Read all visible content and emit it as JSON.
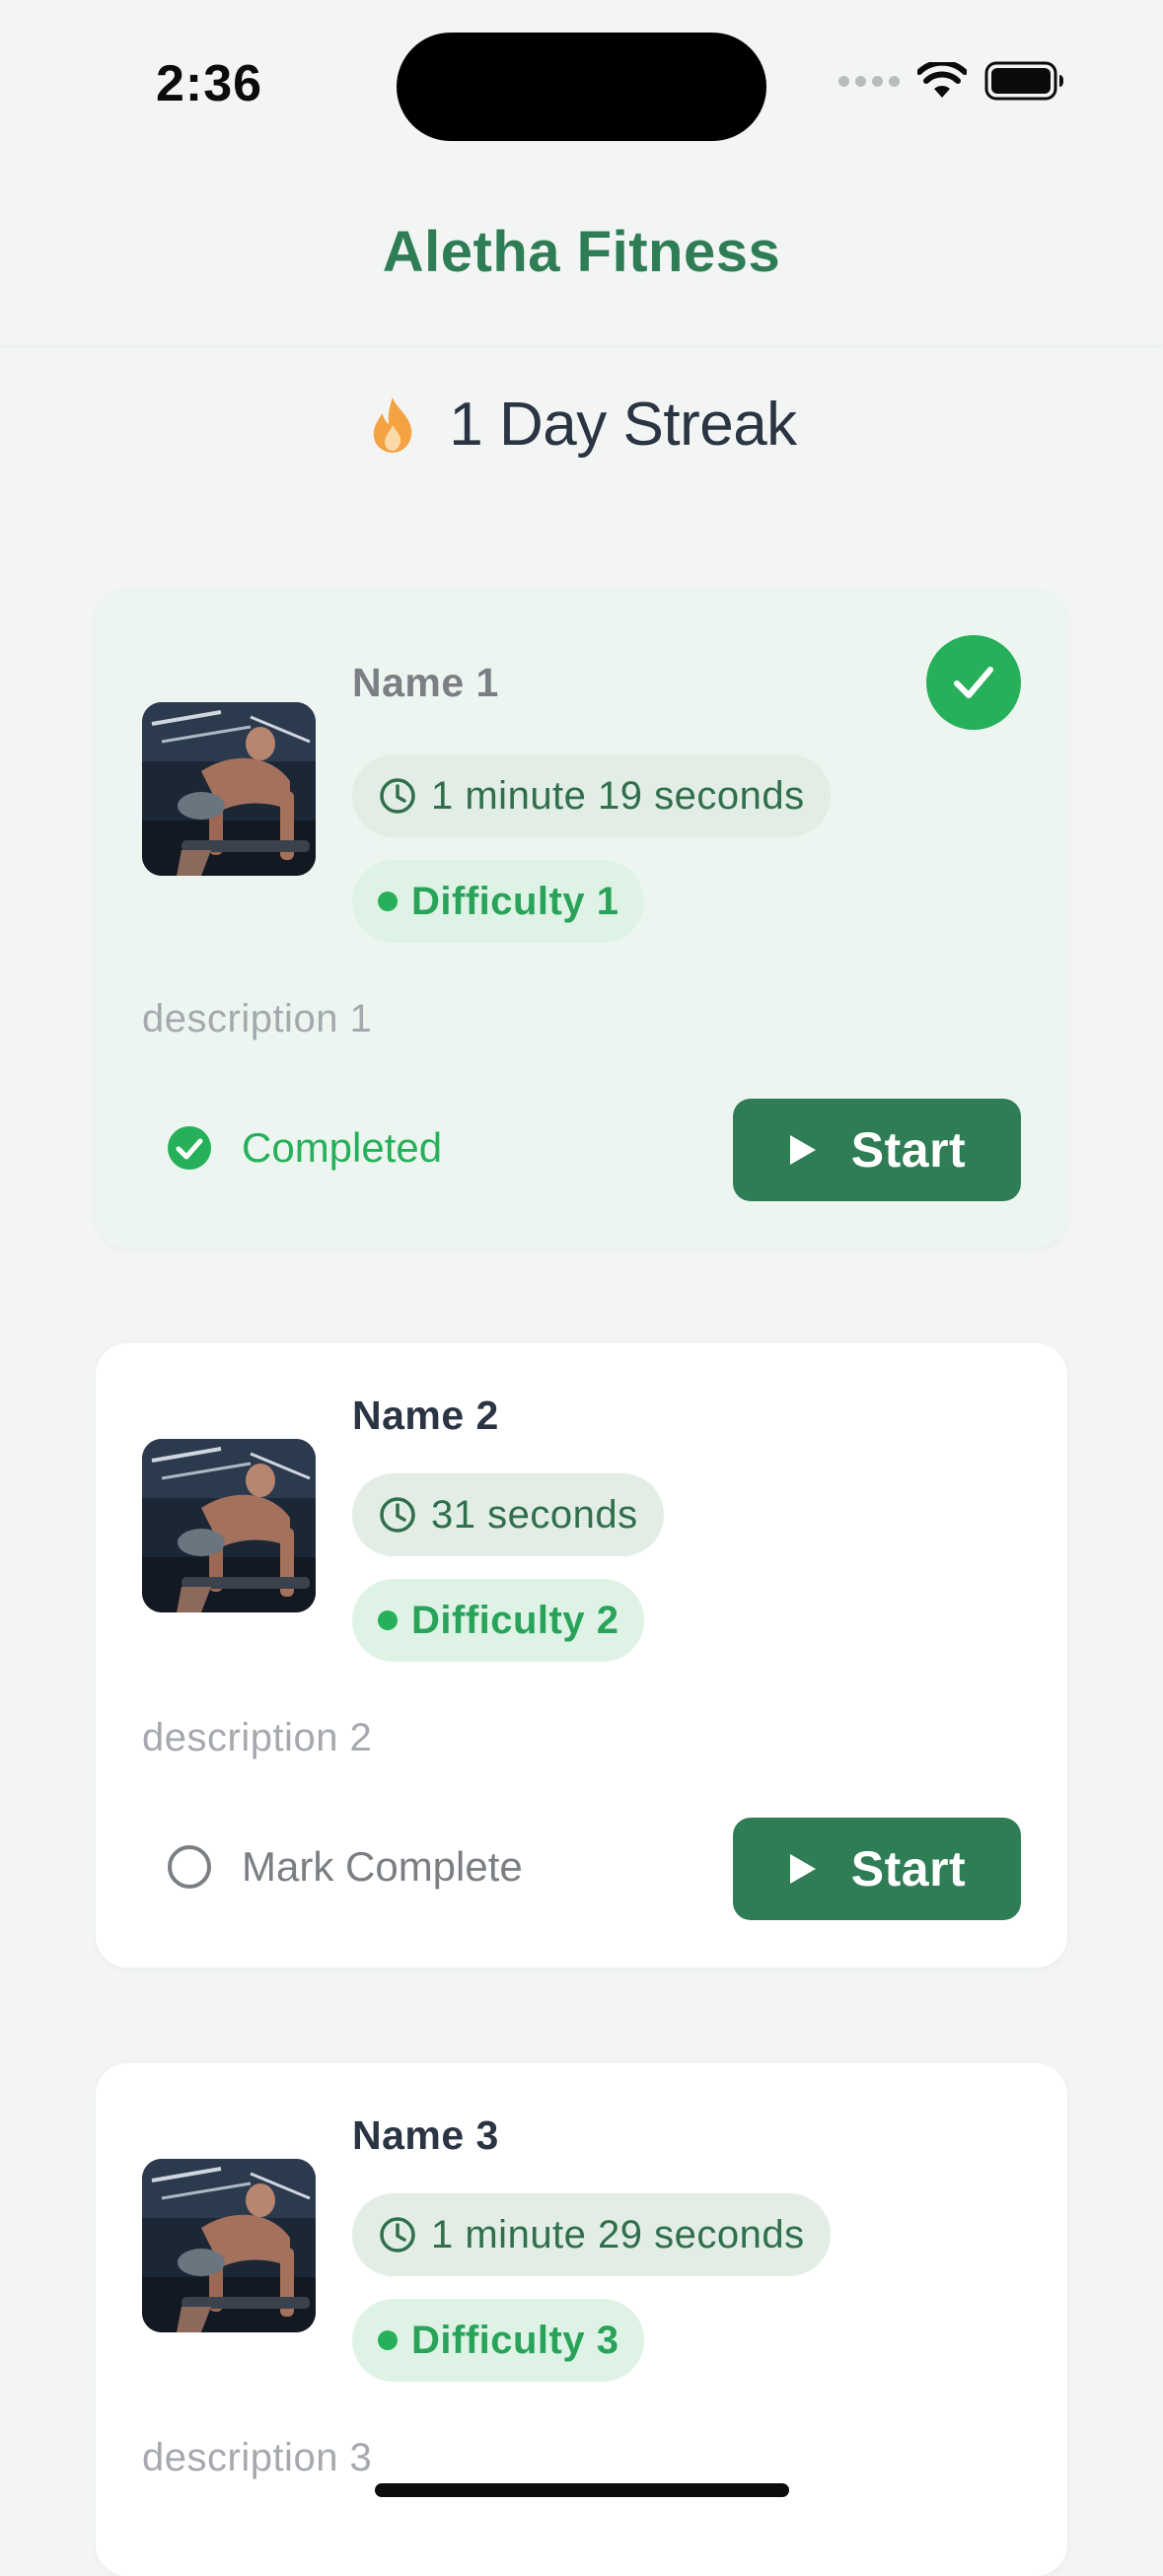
{
  "status_bar": {
    "time": "2:36"
  },
  "header": {
    "title": "Aletha Fitness"
  },
  "streak": {
    "text": "1 Day Streak",
    "icon": "flame-icon"
  },
  "workouts": [
    {
      "name": "Name 1",
      "duration": "1 minute 19 seconds",
      "difficulty": "Difficulty 1",
      "description": "description 1",
      "completed": true,
      "status_label": "Completed",
      "start_label": "Start"
    },
    {
      "name": "Name 2",
      "duration": "31 seconds",
      "difficulty": "Difficulty 2",
      "description": "description 2",
      "completed": false,
      "status_label": "Mark Complete",
      "start_label": "Start"
    },
    {
      "name": "Name 3",
      "duration": "1 minute 29 seconds",
      "difficulty": "Difficulty 3",
      "description": "description 3",
      "completed": false
    }
  ],
  "colors": {
    "brand": "#2e7d55",
    "success": "#27b05a",
    "background": "#f2f5f4",
    "completed_card": "#edf5f1"
  }
}
